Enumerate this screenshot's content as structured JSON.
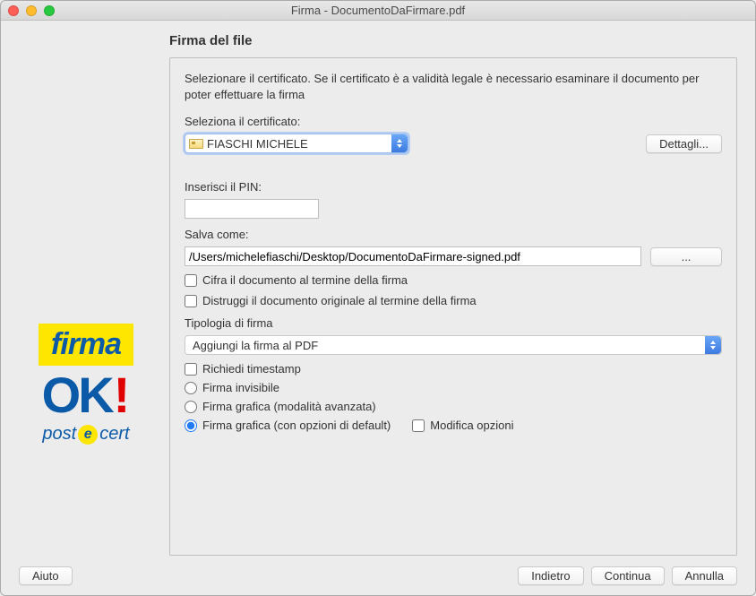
{
  "window": {
    "title": "Firma - DocumentoDaFirmare.pdf"
  },
  "page": {
    "heading": "Firma del file",
    "instruction": "Selezionare il certificato. Se il certificato è a validità legale è necessario esaminare il documento per poter effettuare la firma"
  },
  "certificate": {
    "label": "Seleziona il certificato:",
    "selected": "FIASCHI MICHELE",
    "details_btn": "Dettagli..."
  },
  "pin": {
    "label": "Inserisci il PIN:",
    "value": ""
  },
  "saveas": {
    "label": "Salva come:",
    "path": "/Users/michelefiaschi/Desktop/DocumentoDaFirmare-signed.pdf",
    "browse": "..."
  },
  "options": {
    "cifra": "Cifra il documento al termine della firma",
    "distruggi": "Distruggi il documento originale al termine della firma",
    "tipologia_label": "Tipologia di firma",
    "tipologia_selected": "Aggiungi la firma al PDF",
    "timestamp": "Richiedi timestamp",
    "radio_invisible": "Firma invisibile",
    "radio_advanced": "Firma grafica (modalità avanzata)",
    "radio_default": "Firma grafica (con opzioni di default)",
    "modify": "Modifica opzioni"
  },
  "footer": {
    "help": "Aiuto",
    "back": "Indietro",
    "next": "Continua",
    "cancel": "Annulla"
  },
  "logo": {
    "firma": "firma",
    "ok": "OK",
    "post": "post",
    "e": "e",
    "cert": "cert"
  }
}
